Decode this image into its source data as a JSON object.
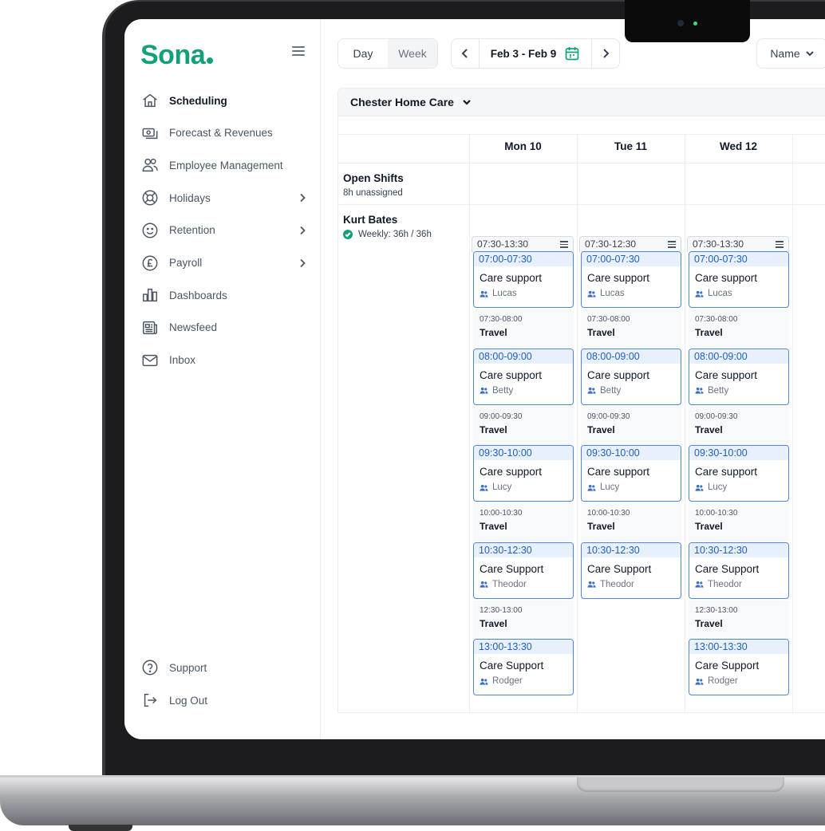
{
  "app": {
    "logo": "Sona"
  },
  "sidebar": {
    "items": [
      {
        "label": "Scheduling",
        "icon": "home-icon",
        "active": true,
        "chevron": false
      },
      {
        "label": "Forecast & Revenues",
        "icon": "money-icon",
        "active": false,
        "chevron": false
      },
      {
        "label": "Employee Management",
        "icon": "users-icon",
        "active": false,
        "chevron": false
      },
      {
        "label": "Holidays",
        "icon": "lifebuoy-icon",
        "active": false,
        "chevron": true
      },
      {
        "label": "Retention",
        "icon": "smile-icon",
        "active": false,
        "chevron": true
      },
      {
        "label": "Payroll",
        "icon": "pound-icon",
        "active": false,
        "chevron": true
      },
      {
        "label": "Dashboards",
        "icon": "bar-chart-icon",
        "active": false,
        "chevron": false
      },
      {
        "label": "Newsfeed",
        "icon": "newspaper-icon",
        "active": false,
        "chevron": false
      },
      {
        "label": "Inbox",
        "icon": "mail-icon",
        "active": false,
        "chevron": false
      }
    ],
    "support": "Support",
    "logout": "Log Out"
  },
  "toolbar": {
    "view_day": "Day",
    "view_week": "Week",
    "date_range": "Feb 3 - Feb 9",
    "sort_label": "Name"
  },
  "location": {
    "name": "Chester Home Care"
  },
  "days": [
    "Mon 10",
    "Tue 11",
    "Wed 12"
  ],
  "open_shifts": {
    "label": "Open Shifts",
    "sub": "8h unassigned"
  },
  "employee": {
    "name": "Kurt Bates",
    "weekly": "Weekly: 36h / 36h"
  },
  "columns": [
    {
      "range": "07:30-13:30",
      "blocks": [
        {
          "kind": "card",
          "time": "07:00-07:30",
          "title": "Care support",
          "who": "Lucas"
        },
        {
          "kind": "travel",
          "time": "07:30-08:00",
          "title": "Travel"
        },
        {
          "kind": "card",
          "time": "08:00-09:00",
          "title": "Care support",
          "who": "Betty"
        },
        {
          "kind": "travel",
          "time": "09:00-09:30",
          "title": "Travel"
        },
        {
          "kind": "card",
          "time": "09:30-10:00",
          "title": "Care support",
          "who": "Lucy"
        },
        {
          "kind": "travel",
          "time": "10:00-10:30",
          "title": "Travel"
        },
        {
          "kind": "card",
          "time": "10:30-12:30",
          "title": "Care Support",
          "who": "Theodor"
        },
        {
          "kind": "travel",
          "time": "12:30-13:00",
          "title": "Travel"
        },
        {
          "kind": "card",
          "time": "13:00-13:30",
          "title": "Care Support",
          "who": "Rodger"
        }
      ]
    },
    {
      "range": "07:30-12:30",
      "blocks": [
        {
          "kind": "card",
          "time": "07:00-07:30",
          "title": "Care support",
          "who": "Lucas"
        },
        {
          "kind": "travel",
          "time": "07:30-08:00",
          "title": "Travel"
        },
        {
          "kind": "card",
          "time": "08:00-09:00",
          "title": "Care support",
          "who": "Betty"
        },
        {
          "kind": "travel",
          "time": "09:00-09:30",
          "title": "Travel"
        },
        {
          "kind": "card",
          "time": "09:30-10:00",
          "title": "Care support",
          "who": "Lucy"
        },
        {
          "kind": "travel",
          "time": "10:00-10:30",
          "title": "Travel"
        },
        {
          "kind": "card",
          "time": "10:30-12:30",
          "title": "Care Support",
          "who": "Theodor"
        }
      ]
    },
    {
      "range": "07:30-13:30",
      "blocks": [
        {
          "kind": "card",
          "time": "07:00-07:30",
          "title": "Care support",
          "who": "Lucas"
        },
        {
          "kind": "travel",
          "time": "07:30-08:00",
          "title": "Travel"
        },
        {
          "kind": "card",
          "time": "08:00-09:00",
          "title": "Care support",
          "who": "Betty"
        },
        {
          "kind": "travel",
          "time": "09:00-09:30",
          "title": "Travel"
        },
        {
          "kind": "card",
          "time": "09:30-10:00",
          "title": "Care support",
          "who": "Lucy"
        },
        {
          "kind": "travel",
          "time": "10:00-10:30",
          "title": "Travel"
        },
        {
          "kind": "card",
          "time": "10:30-12:30",
          "title": "Care Support",
          "who": "Theodor"
        },
        {
          "kind": "travel",
          "time": "12:30-13:00",
          "title": "Travel"
        },
        {
          "kind": "card",
          "time": "13:00-13:30",
          "title": "Care Support",
          "who": "Rodger"
        }
      ]
    }
  ],
  "colors": {
    "brand": "#12a07b",
    "shift_border": "#4f86d9",
    "shift_time": "#1f5fbf"
  }
}
